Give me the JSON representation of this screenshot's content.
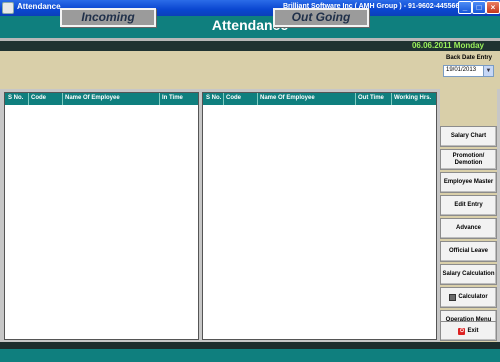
{
  "window": {
    "title": "Attendance",
    "company": "Brilliant Software Inc ( AMH Group ) - 91-9602-445566",
    "controls": {
      "minimize": "_",
      "maximize": "□",
      "close": "×"
    }
  },
  "header": {
    "title": "Attendance"
  },
  "date_bar": {
    "text": "06.06.2011 Monday"
  },
  "band": {
    "incoming_label": "Incoming",
    "outgoing_label": "Out Going"
  },
  "back_date": {
    "label": "Back Date Entry",
    "value": "19/01/2013"
  },
  "incoming_table": {
    "columns": [
      "S No.",
      "Code",
      "Name Of Employee",
      "In Time"
    ],
    "rows": []
  },
  "outgoing_table": {
    "columns": [
      "S No.",
      "Code",
      "Name Of Employee",
      "Out Time",
      "Working Hrs."
    ],
    "rows": []
  },
  "side_buttons": [
    {
      "label": "Salary Chart",
      "icon": ""
    },
    {
      "label": "Promotion/ Demotion",
      "icon": ""
    },
    {
      "label": "Employee Master",
      "icon": ""
    },
    {
      "label": "Edit Entry",
      "icon": ""
    },
    {
      "label": "Advance",
      "icon": ""
    },
    {
      "label": "Official Leave",
      "icon": ""
    },
    {
      "label": "Salary Calculation",
      "icon": ""
    },
    {
      "label": "Calculator",
      "icon": "calculator-icon"
    },
    {
      "label": "Operation Menu",
      "icon": ""
    },
    {
      "label": "Exit",
      "icon": "exit-icon"
    }
  ],
  "colors": {
    "teal": "#0f7f7e",
    "tan": "#d9cfa9",
    "date_green": "#9af05a",
    "xp_blue": "#0a46d0"
  }
}
